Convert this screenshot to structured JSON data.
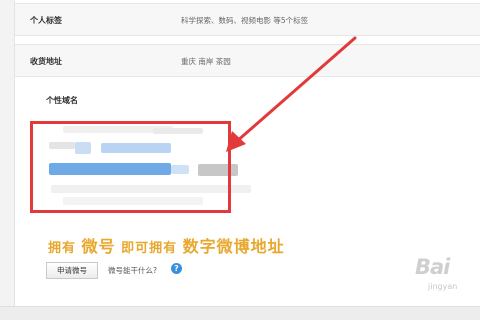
{
  "profile": {
    "tags_label": "个人标签",
    "tags_value": "科学探索、数码、视频电影 等5个标签",
    "address_label": "收货地址",
    "address_value": "重庆 南岸 茶园",
    "domain_label": "个性域名"
  },
  "promo": {
    "part1": "拥有",
    "part2": "微号",
    "part3": "即可拥有",
    "part4": "数字微博地址"
  },
  "actions": {
    "apply_label": "申请微号",
    "help_text": "微号能干什么?",
    "help_icon_glyph": "?"
  },
  "watermark": {
    "text": "Bai",
    "sub": "jingyan"
  },
  "colors": {
    "highlight_border": "#e23a3a",
    "promo_text": "#e8a82e",
    "help_icon": "#3a8fdd"
  }
}
